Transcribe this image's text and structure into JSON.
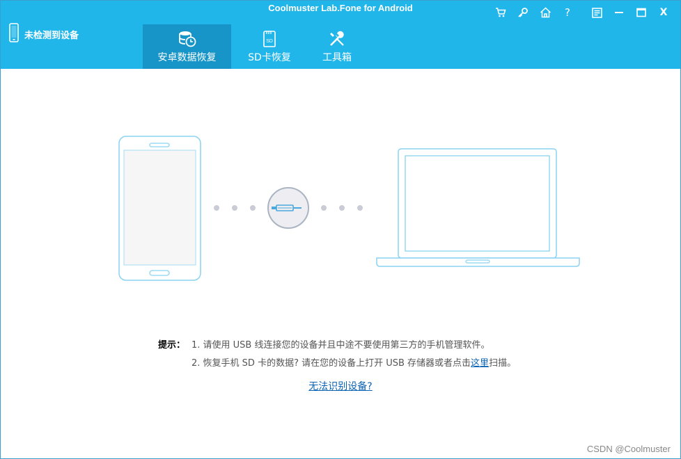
{
  "window": {
    "title": "Coolmuster Lab.Fone for Android"
  },
  "controls": {
    "cart": "cart-icon",
    "key": "key-icon",
    "home": "home-icon",
    "help_label": "?",
    "feedback": "feedback-icon",
    "minimize": "minimize-icon",
    "maximize": "maximize-icon",
    "close_label": "X"
  },
  "device": {
    "status": "未检测到设备"
  },
  "tabs": [
    {
      "label": "安卓数据恢复",
      "icon": "database-clock-icon",
      "active": true
    },
    {
      "label": "SD卡恢复",
      "icon": "sd-card-icon",
      "active": false
    },
    {
      "label": "工具箱",
      "icon": "tools-icon",
      "active": false
    }
  ],
  "hints": {
    "label": "提示：",
    "line1": "1. 请使用 USB 线连接您的设备并且中途不要使用第三方的手机管理软件。",
    "line2_prefix": "2. 恢复手机 SD 卡的数据? 请在您的设备上打开 USB 存储器或者点击",
    "line2_link": "这里",
    "line2_suffix": "扫描。"
  },
  "help_link": "无法识别设备?",
  "watermark": "CSDN @Coolmuster",
  "colors": {
    "header": "#21b6ea",
    "active_tab": "#1795c8",
    "outline": "#8ad3f2",
    "dots": "#c9ccd4",
    "link": "#0b63b5"
  }
}
